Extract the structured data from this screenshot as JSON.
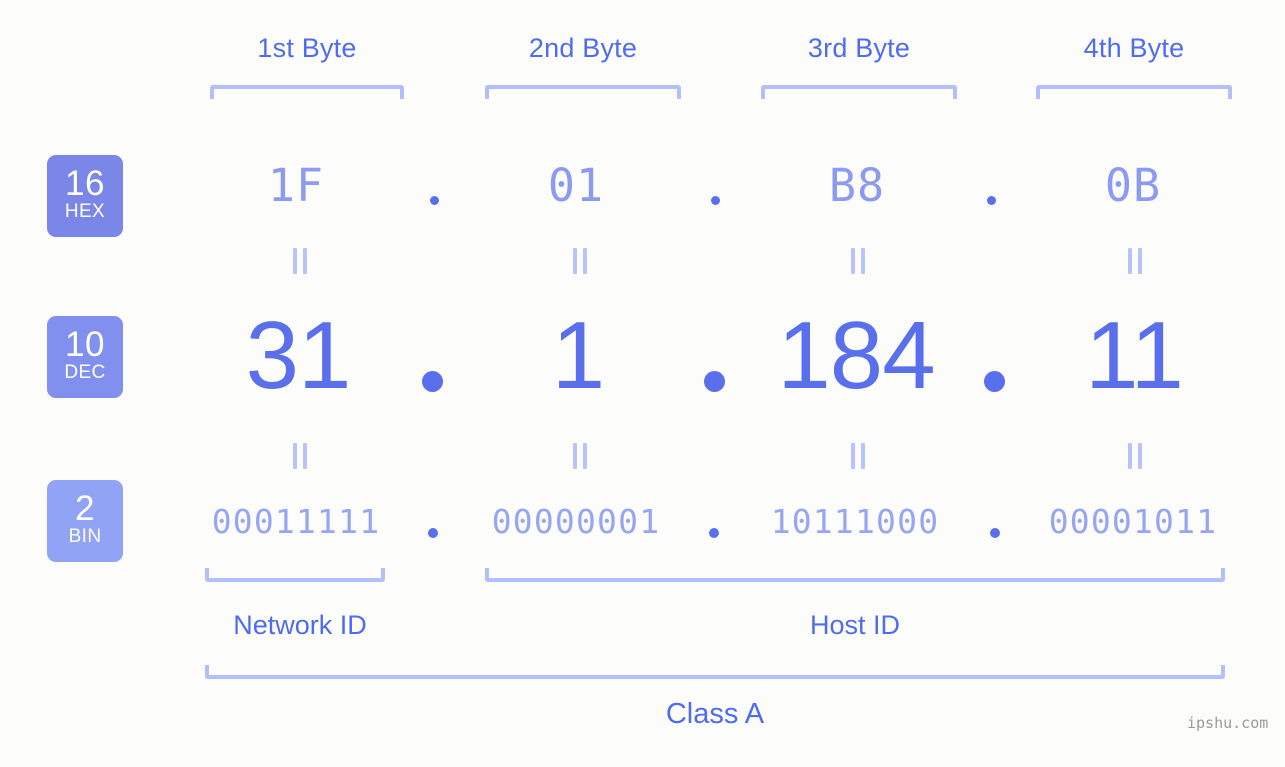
{
  "background_color": "#fcfdfa",
  "accent_color": "#4f6bf0",
  "bracket_color": "#b3bffa",
  "byte_headers": [
    {
      "label": "1st Byte"
    },
    {
      "label": "2nd Byte"
    },
    {
      "label": "3rd Byte"
    },
    {
      "label": "4th Byte"
    }
  ],
  "rows": {
    "hex": {
      "badge_number": "16",
      "badge_caption": "HEX",
      "badge_color": "#7a87e8",
      "values": [
        "1F",
        "01",
        "B8",
        "0B"
      ],
      "separator": "."
    },
    "dec": {
      "badge_number": "10",
      "badge_caption": "DEC",
      "badge_color": "#8190ef",
      "values": [
        "31",
        "1",
        "184",
        "11"
      ],
      "separator": "."
    },
    "bin": {
      "badge_number": "2",
      "badge_caption": "BIN",
      "badge_color": "#90a3f5",
      "values": [
        "00011111",
        "00000001",
        "10111000",
        "00001011"
      ],
      "separator": "."
    }
  },
  "equality_marks": {
    "symbol": "=",
    "count_per_gap": 4
  },
  "segments": {
    "network_id": "Network ID",
    "host_id": "Host ID"
  },
  "class_label": "Class A",
  "watermark": "ipshu.com"
}
